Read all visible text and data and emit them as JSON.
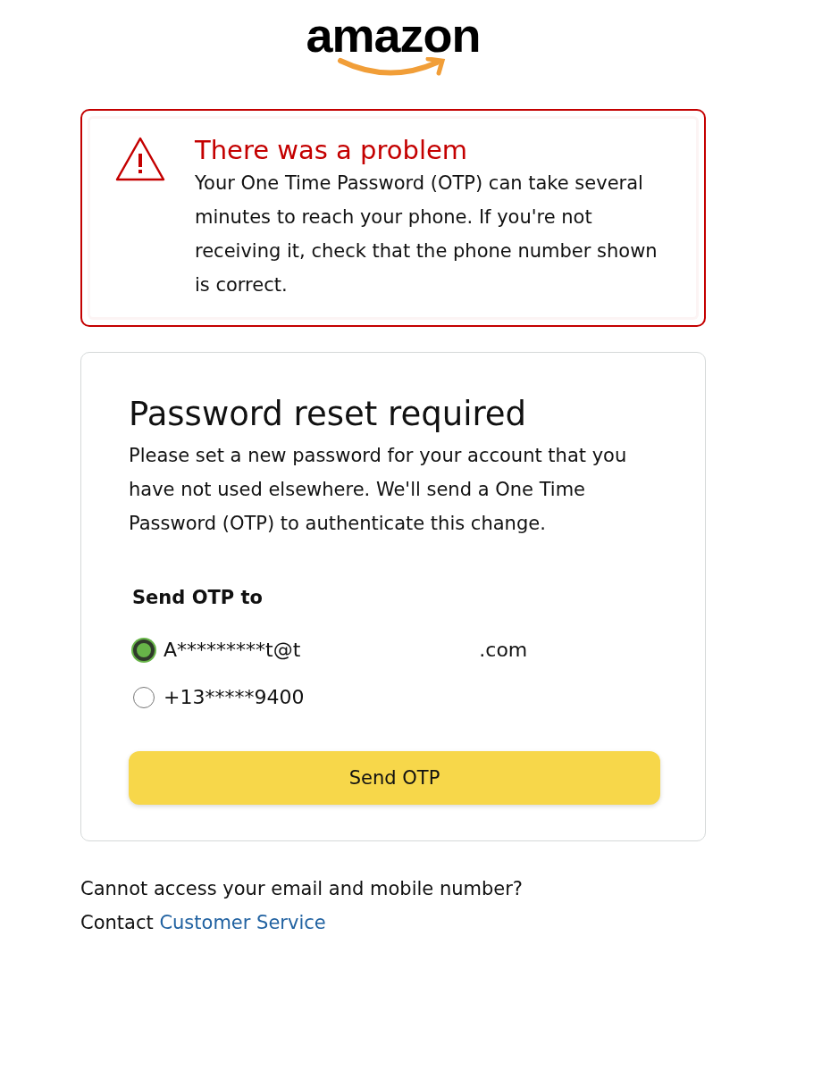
{
  "logo": {
    "text": "amazon"
  },
  "alert": {
    "title": "There was a problem",
    "message": "Your One Time Password (OTP) can take several minutes to reach your phone. If you're not receiving it, check that the phone number shown is correct."
  },
  "card": {
    "title": "Password reset required",
    "description": "Please set a new password for your account that you have not used elsewhere. We'll send a One Time Password (OTP) to authenticate this change.",
    "group_label": "Send OTP to",
    "options": [
      {
        "parts": [
          "A*********t@t",
          ".com"
        ],
        "selected": true
      },
      {
        "parts": [
          "+13*****9400"
        ],
        "selected": false
      }
    ],
    "button": "Send OTP"
  },
  "footer": {
    "line1": "Cannot access your email and mobile number?",
    "prefix": "Contact",
    "link": "Customer Service"
  }
}
